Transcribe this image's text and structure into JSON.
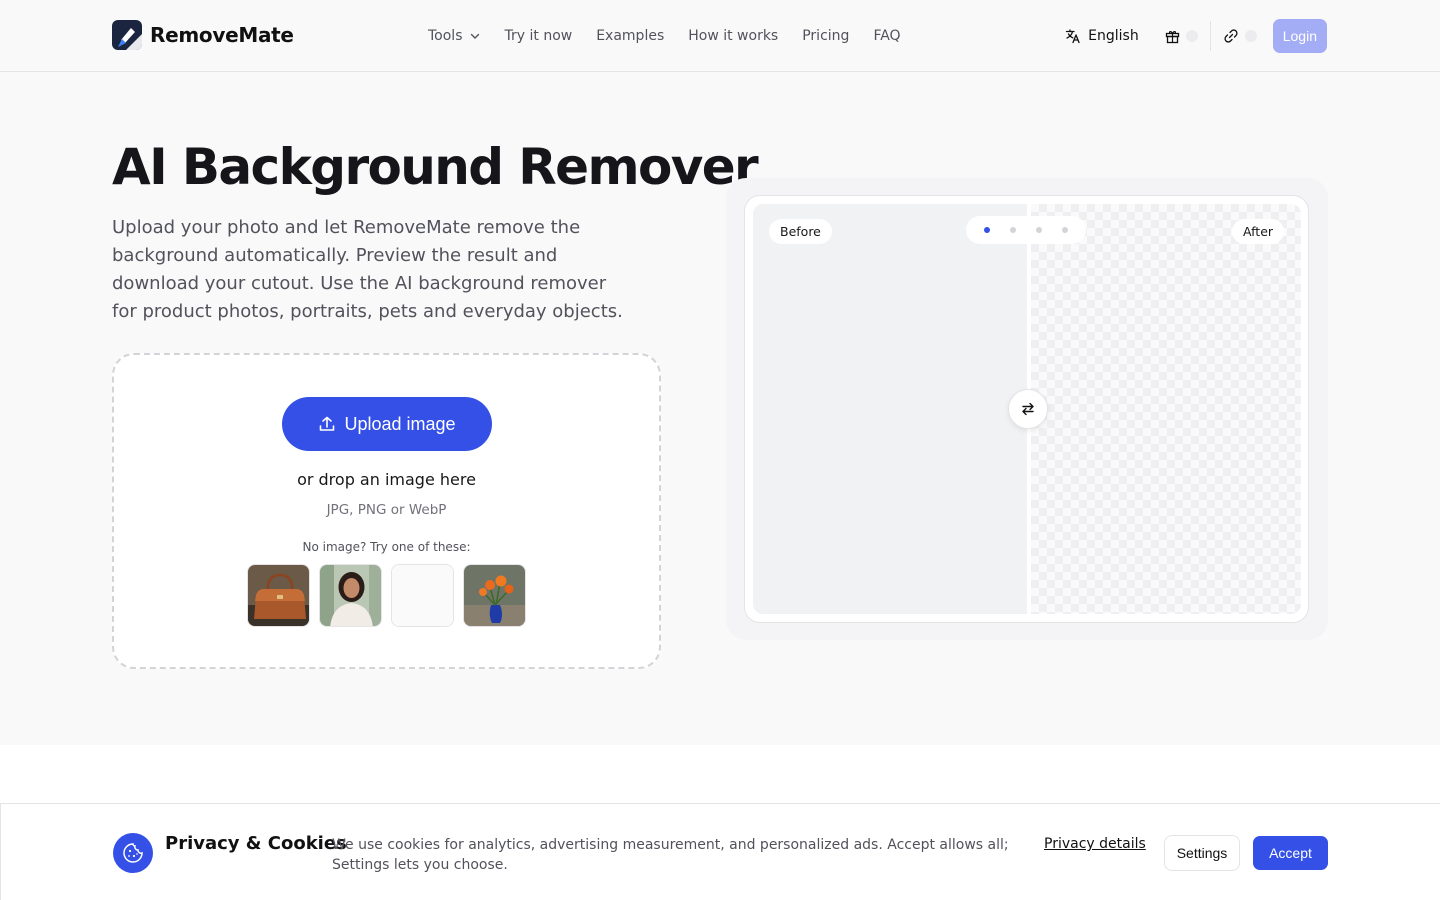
{
  "header": {
    "brand": "RemoveMate",
    "nav": [
      {
        "label": "Tools",
        "has_dropdown": true
      },
      {
        "label": "Try it now"
      },
      {
        "label": "Examples"
      },
      {
        "label": "How it works"
      },
      {
        "label": "Pricing"
      },
      {
        "label": "FAQ"
      }
    ],
    "language": "English",
    "login_label": "Login",
    "icons": [
      "translate-icon",
      "gift-icon",
      "link-icon"
    ]
  },
  "hero": {
    "title": "AI Background Remover",
    "description": "Upload your photo and let RemoveMate remove the background automatically. Preview the result and download your cutout. Use the AI background remover for product photos, portraits, pets and everyday objects."
  },
  "upload": {
    "button_label": "Upload image",
    "drop_text": "or drop an image here",
    "formats": "JPG, PNG or WebP",
    "try_text": "No image? Try one of these:",
    "samples": [
      "handbag",
      "portrait",
      "blank",
      "flowers"
    ]
  },
  "preview": {
    "before_label": "Before",
    "after_label": "After",
    "slides": 4,
    "active_slide": 1
  },
  "cookie": {
    "title": "Privacy & Cookies",
    "text": "We use cookies for analytics, advertising measurement, and personalized ads. Accept allows all; Settings lets you choose.",
    "privacy_link": "Privacy details",
    "settings_label": "Settings",
    "accept_label": "Accept"
  },
  "colors": {
    "accent": "#3450e6",
    "login_bg": "#a3adf5",
    "page_bg": "#f9f9fa"
  }
}
